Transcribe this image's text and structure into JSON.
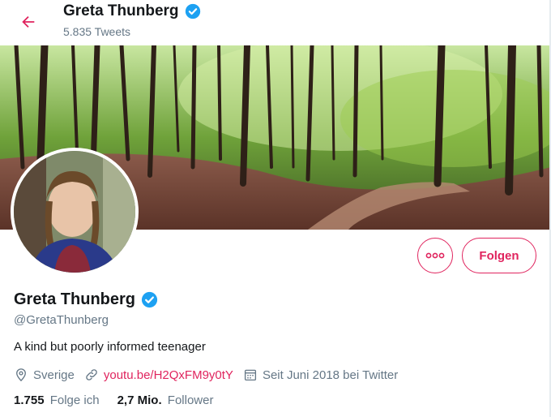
{
  "topbar": {
    "name": "Greta Thunberg",
    "tweet_count": "5.835 Tweets",
    "back_icon": "arrow-left-icon"
  },
  "profile": {
    "name": "Greta Thunberg",
    "handle": "@GretaThunberg",
    "bio": "A kind but poorly informed teenager",
    "location": "Sverige",
    "link": "youtu.be/H2QxFM9y0tY",
    "joined": "Seit Juni 2018 bei Twitter",
    "verified_icon": "verified-badge-icon"
  },
  "actions": {
    "follow_label": "Folgen",
    "more_icon": "more-icon"
  },
  "stats": {
    "following_count": "1.755",
    "following_label": "Folge ich",
    "followers_count": "2,7 Mio.",
    "followers_label": "Follower"
  },
  "colors": {
    "accent": "#e0245e",
    "verified": "#1da1f2",
    "muted": "#657786",
    "text": "#14171a"
  }
}
